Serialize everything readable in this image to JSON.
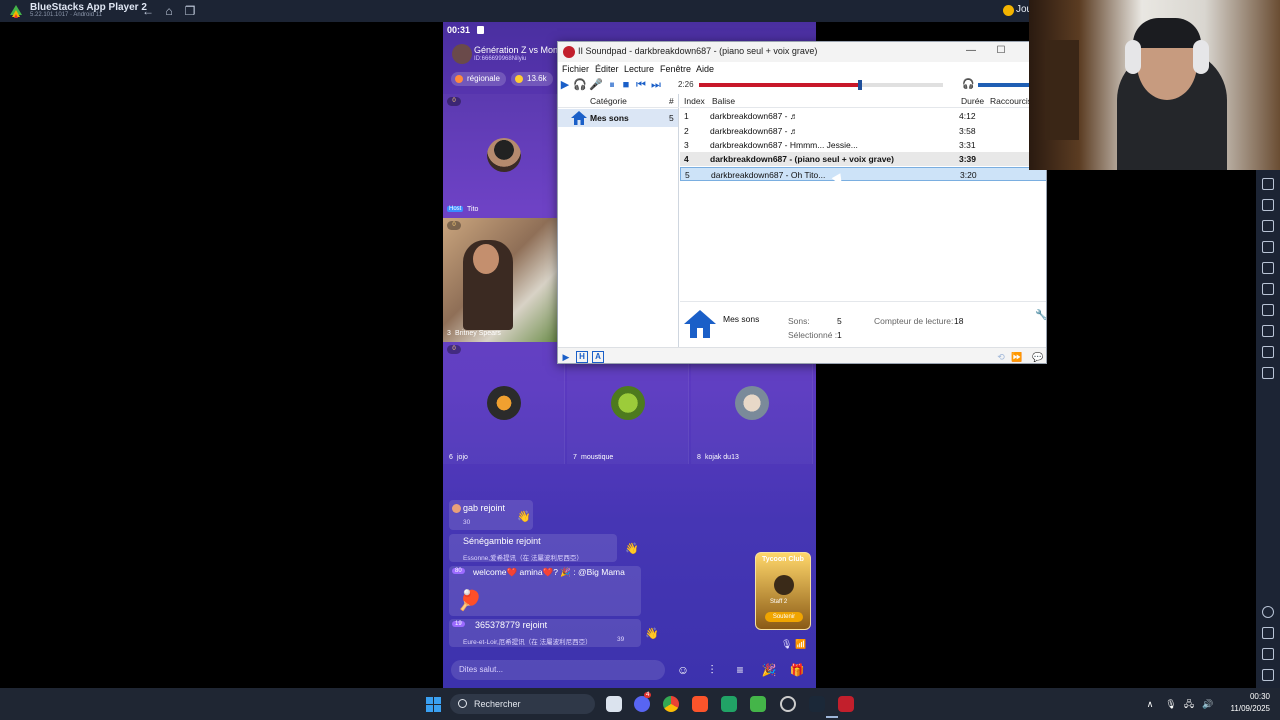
{
  "bluestacks": {
    "title": "BlueStacks App Player 2",
    "subtitle": "5.22.101.1017 · Android 11",
    "top_right_label": "Jou",
    "nav_icons": [
      "back-icon",
      "home-icon",
      "recent-apps-icon"
    ]
  },
  "app": {
    "status_time": "00:31",
    "room_title": "Génération Z vs Monde",
    "room_id": "ID:666699968Nilyiu",
    "chips": [
      {
        "label": "régionale"
      },
      {
        "label": "13.6k"
      }
    ],
    "seats": [
      {
        "number": "",
        "badge": "Host",
        "name": "Tito",
        "score": "0"
      },
      {
        "number": "3",
        "name": "Britney Spears",
        "score": "0"
      },
      {
        "number": "6",
        "name": "jojo",
        "score": "0"
      },
      {
        "number": "7",
        "name": "moustique",
        "score": ""
      },
      {
        "number": "8",
        "name": "kojak du13",
        "score": ""
      }
    ],
    "chat": [
      {
        "name": "gab",
        "action": "rejoint",
        "sub": "30"
      },
      {
        "name": "Sénégambie",
        "action": "rejoint",
        "sub": "Essonne,爱希提讯（在 法屬波利尼西亞）"
      },
      {
        "prefix": "80",
        "text": "welcome❤️ amina❤️? 🎉 : @Big Mama"
      },
      {
        "prefix": "19",
        "name": "365378779",
        "action": "rejoint",
        "sub": "Eure-et-Loir,厄希提讯（在 法屬波利尼西亞）",
        "sub_count": "39"
      }
    ],
    "input_placeholder": "Dites salut...",
    "tycoon": {
      "title": "Tycoon Club",
      "button": "Soutenir",
      "level": "Staff 2"
    }
  },
  "soundpad": {
    "title": "Soundpad - darkbreakdown687 - (piano seul + voix grave)",
    "title_prefix": "II",
    "menu": [
      "Fichier",
      "Éditer",
      "Lecture",
      "Fenêtre",
      "Aide"
    ],
    "time": "2:26",
    "progress": 0.66,
    "categories_header": {
      "category": "Catégorie",
      "count": "#"
    },
    "category": {
      "name": "Mes sons",
      "count": "5"
    },
    "columns": {
      "index": "Index",
      "tag": "Balise",
      "duration": "Durée",
      "hotkey": "Raccourcis"
    },
    "sounds": [
      {
        "index": "1",
        "tag": "darkbreakdown687 - ♬",
        "duration": "4:12",
        "state": ""
      },
      {
        "index": "2",
        "tag": "darkbreakdown687 - ♬",
        "duration": "3:58",
        "state": ""
      },
      {
        "index": "3",
        "tag": "darkbreakdown687 - Hmmm... Jessie...",
        "duration": "3:31",
        "state": ""
      },
      {
        "index": "4",
        "tag": "darkbreakdown687 - (piano seul + voix grave)",
        "duration": "3:39",
        "state": "active"
      },
      {
        "index": "5",
        "tag": "darkbreakdown687 - Oh Tito...",
        "duration": "3:20",
        "state": "selected"
      }
    ],
    "info": {
      "category": "Mes sons",
      "sounds_label": "Sons:",
      "sounds_value": "5",
      "selected_label": "Sélectionné :",
      "selected_value": "1",
      "counter_label": "Compteur de lecture:",
      "counter_value": "18"
    },
    "bottom_buttons": {
      "h": "H",
      "a": "A"
    }
  },
  "taskbar": {
    "search_placeholder": "Rechercher",
    "time": "00:30",
    "date": "11/09/2025",
    "discord_badge": "4"
  },
  "colors": {
    "accent_red": "#c8172a",
    "accent_blue": "#1a5fc8",
    "selection": "#cde3f8"
  }
}
